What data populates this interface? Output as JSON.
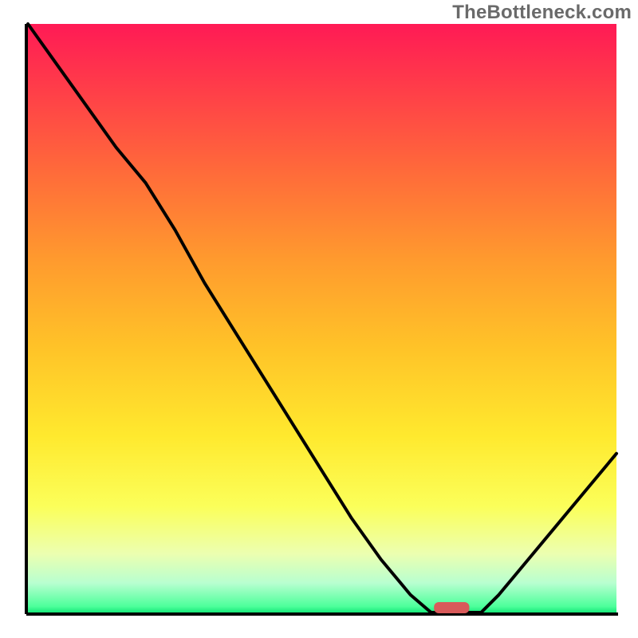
{
  "watermark": "TheBottleneck.com",
  "colors": {
    "curve": "#000000",
    "marker": "#d95a5a",
    "gradient_top": "#ff1a55",
    "gradient_bottom": "#17e87a"
  },
  "chart_data": {
    "type": "line",
    "title": "",
    "xlabel": "",
    "ylabel": "",
    "xlim": [
      0,
      1
    ],
    "ylim": [
      0,
      100
    ],
    "x": [
      0.0,
      0.05,
      0.1,
      0.15,
      0.2,
      0.25,
      0.3,
      0.35,
      0.4,
      0.45,
      0.5,
      0.55,
      0.6,
      0.65,
      0.685,
      0.72,
      0.77,
      0.8,
      0.85,
      0.9,
      0.95,
      1.0
    ],
    "values": [
      100,
      93,
      86,
      79,
      73,
      65,
      56,
      48,
      40,
      32,
      24,
      16,
      9,
      3,
      0,
      0,
      0,
      3,
      9,
      15,
      21,
      27
    ],
    "optimal_x": 0.72,
    "optimal_span": 0.06
  }
}
